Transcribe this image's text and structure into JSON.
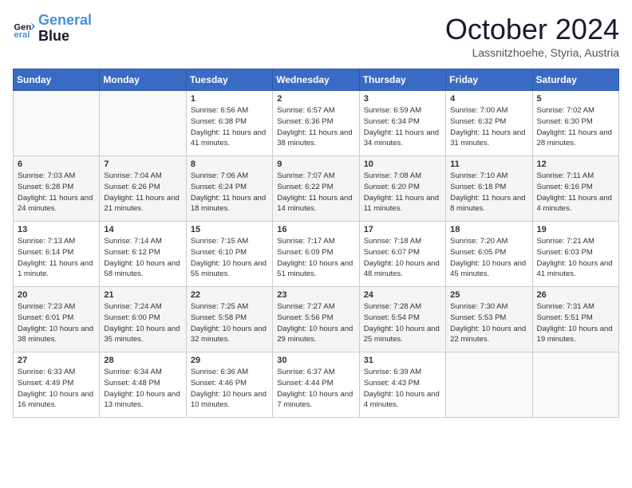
{
  "logo": {
    "line1": "General",
    "line2": "Blue"
  },
  "title": "October 2024",
  "subtitle": "Lassnitzhoehe, Styria, Austria",
  "weekdays": [
    "Sunday",
    "Monday",
    "Tuesday",
    "Wednesday",
    "Thursday",
    "Friday",
    "Saturday"
  ],
  "weeks": [
    [
      {
        "day": "",
        "info": ""
      },
      {
        "day": "",
        "info": ""
      },
      {
        "day": "1",
        "info": "Sunrise: 6:56 AM\nSunset: 6:38 PM\nDaylight: 11 hours and 41 minutes."
      },
      {
        "day": "2",
        "info": "Sunrise: 6:57 AM\nSunset: 6:36 PM\nDaylight: 11 hours and 38 minutes."
      },
      {
        "day": "3",
        "info": "Sunrise: 6:59 AM\nSunset: 6:34 PM\nDaylight: 11 hours and 34 minutes."
      },
      {
        "day": "4",
        "info": "Sunrise: 7:00 AM\nSunset: 6:32 PM\nDaylight: 11 hours and 31 minutes."
      },
      {
        "day": "5",
        "info": "Sunrise: 7:02 AM\nSunset: 6:30 PM\nDaylight: 11 hours and 28 minutes."
      }
    ],
    [
      {
        "day": "6",
        "info": "Sunrise: 7:03 AM\nSunset: 6:28 PM\nDaylight: 11 hours and 24 minutes."
      },
      {
        "day": "7",
        "info": "Sunrise: 7:04 AM\nSunset: 6:26 PM\nDaylight: 11 hours and 21 minutes."
      },
      {
        "day": "8",
        "info": "Sunrise: 7:06 AM\nSunset: 6:24 PM\nDaylight: 11 hours and 18 minutes."
      },
      {
        "day": "9",
        "info": "Sunrise: 7:07 AM\nSunset: 6:22 PM\nDaylight: 11 hours and 14 minutes."
      },
      {
        "day": "10",
        "info": "Sunrise: 7:08 AM\nSunset: 6:20 PM\nDaylight: 11 hours and 11 minutes."
      },
      {
        "day": "11",
        "info": "Sunrise: 7:10 AM\nSunset: 6:18 PM\nDaylight: 11 hours and 8 minutes."
      },
      {
        "day": "12",
        "info": "Sunrise: 7:11 AM\nSunset: 6:16 PM\nDaylight: 11 hours and 4 minutes."
      }
    ],
    [
      {
        "day": "13",
        "info": "Sunrise: 7:13 AM\nSunset: 6:14 PM\nDaylight: 11 hours and 1 minute."
      },
      {
        "day": "14",
        "info": "Sunrise: 7:14 AM\nSunset: 6:12 PM\nDaylight: 10 hours and 58 minutes."
      },
      {
        "day": "15",
        "info": "Sunrise: 7:15 AM\nSunset: 6:10 PM\nDaylight: 10 hours and 55 minutes."
      },
      {
        "day": "16",
        "info": "Sunrise: 7:17 AM\nSunset: 6:09 PM\nDaylight: 10 hours and 51 minutes."
      },
      {
        "day": "17",
        "info": "Sunrise: 7:18 AM\nSunset: 6:07 PM\nDaylight: 10 hours and 48 minutes."
      },
      {
        "day": "18",
        "info": "Sunrise: 7:20 AM\nSunset: 6:05 PM\nDaylight: 10 hours and 45 minutes."
      },
      {
        "day": "19",
        "info": "Sunrise: 7:21 AM\nSunset: 6:03 PM\nDaylight: 10 hours and 41 minutes."
      }
    ],
    [
      {
        "day": "20",
        "info": "Sunrise: 7:23 AM\nSunset: 6:01 PM\nDaylight: 10 hours and 38 minutes."
      },
      {
        "day": "21",
        "info": "Sunrise: 7:24 AM\nSunset: 6:00 PM\nDaylight: 10 hours and 35 minutes."
      },
      {
        "day": "22",
        "info": "Sunrise: 7:25 AM\nSunset: 5:58 PM\nDaylight: 10 hours and 32 minutes."
      },
      {
        "day": "23",
        "info": "Sunrise: 7:27 AM\nSunset: 5:56 PM\nDaylight: 10 hours and 29 minutes."
      },
      {
        "day": "24",
        "info": "Sunrise: 7:28 AM\nSunset: 5:54 PM\nDaylight: 10 hours and 25 minutes."
      },
      {
        "day": "25",
        "info": "Sunrise: 7:30 AM\nSunset: 5:53 PM\nDaylight: 10 hours and 22 minutes."
      },
      {
        "day": "26",
        "info": "Sunrise: 7:31 AM\nSunset: 5:51 PM\nDaylight: 10 hours and 19 minutes."
      }
    ],
    [
      {
        "day": "27",
        "info": "Sunrise: 6:33 AM\nSunset: 4:49 PM\nDaylight: 10 hours and 16 minutes."
      },
      {
        "day": "28",
        "info": "Sunrise: 6:34 AM\nSunset: 4:48 PM\nDaylight: 10 hours and 13 minutes."
      },
      {
        "day": "29",
        "info": "Sunrise: 6:36 AM\nSunset: 4:46 PM\nDaylight: 10 hours and 10 minutes."
      },
      {
        "day": "30",
        "info": "Sunrise: 6:37 AM\nSunset: 4:44 PM\nDaylight: 10 hours and 7 minutes."
      },
      {
        "day": "31",
        "info": "Sunrise: 6:39 AM\nSunset: 4:43 PM\nDaylight: 10 hours and 4 minutes."
      },
      {
        "day": "",
        "info": ""
      },
      {
        "day": "",
        "info": ""
      }
    ]
  ]
}
